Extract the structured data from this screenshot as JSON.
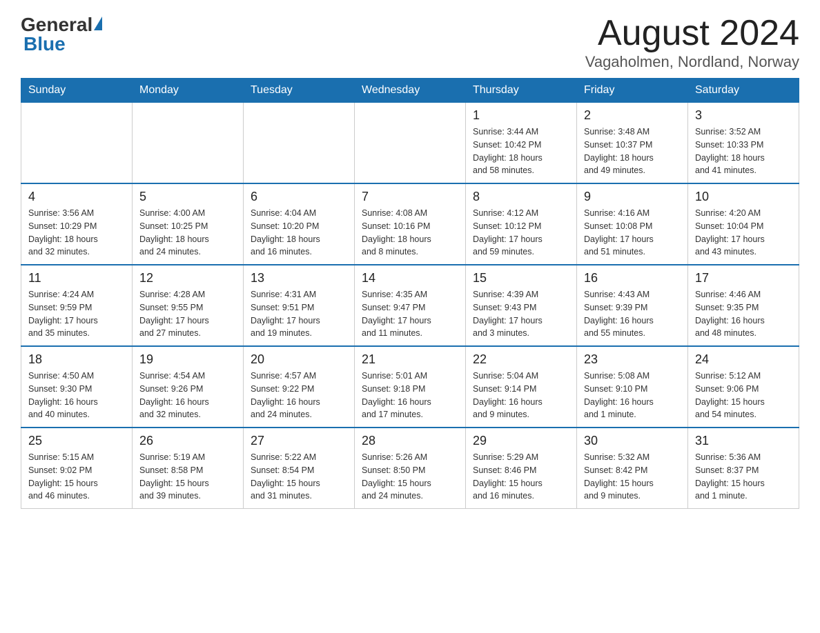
{
  "header": {
    "logo_general": "General",
    "logo_blue": "Blue",
    "month_title": "August 2024",
    "location": "Vagaholmen, Nordland, Norway"
  },
  "weekdays": [
    "Sunday",
    "Monday",
    "Tuesday",
    "Wednesday",
    "Thursday",
    "Friday",
    "Saturday"
  ],
  "weeks": [
    [
      {
        "day": "",
        "info": ""
      },
      {
        "day": "",
        "info": ""
      },
      {
        "day": "",
        "info": ""
      },
      {
        "day": "",
        "info": ""
      },
      {
        "day": "1",
        "info": "Sunrise: 3:44 AM\nSunset: 10:42 PM\nDaylight: 18 hours\nand 58 minutes."
      },
      {
        "day": "2",
        "info": "Sunrise: 3:48 AM\nSunset: 10:37 PM\nDaylight: 18 hours\nand 49 minutes."
      },
      {
        "day": "3",
        "info": "Sunrise: 3:52 AM\nSunset: 10:33 PM\nDaylight: 18 hours\nand 41 minutes."
      }
    ],
    [
      {
        "day": "4",
        "info": "Sunrise: 3:56 AM\nSunset: 10:29 PM\nDaylight: 18 hours\nand 32 minutes."
      },
      {
        "day": "5",
        "info": "Sunrise: 4:00 AM\nSunset: 10:25 PM\nDaylight: 18 hours\nand 24 minutes."
      },
      {
        "day": "6",
        "info": "Sunrise: 4:04 AM\nSunset: 10:20 PM\nDaylight: 18 hours\nand 16 minutes."
      },
      {
        "day": "7",
        "info": "Sunrise: 4:08 AM\nSunset: 10:16 PM\nDaylight: 18 hours\nand 8 minutes."
      },
      {
        "day": "8",
        "info": "Sunrise: 4:12 AM\nSunset: 10:12 PM\nDaylight: 17 hours\nand 59 minutes."
      },
      {
        "day": "9",
        "info": "Sunrise: 4:16 AM\nSunset: 10:08 PM\nDaylight: 17 hours\nand 51 minutes."
      },
      {
        "day": "10",
        "info": "Sunrise: 4:20 AM\nSunset: 10:04 PM\nDaylight: 17 hours\nand 43 minutes."
      }
    ],
    [
      {
        "day": "11",
        "info": "Sunrise: 4:24 AM\nSunset: 9:59 PM\nDaylight: 17 hours\nand 35 minutes."
      },
      {
        "day": "12",
        "info": "Sunrise: 4:28 AM\nSunset: 9:55 PM\nDaylight: 17 hours\nand 27 minutes."
      },
      {
        "day": "13",
        "info": "Sunrise: 4:31 AM\nSunset: 9:51 PM\nDaylight: 17 hours\nand 19 minutes."
      },
      {
        "day": "14",
        "info": "Sunrise: 4:35 AM\nSunset: 9:47 PM\nDaylight: 17 hours\nand 11 minutes."
      },
      {
        "day": "15",
        "info": "Sunrise: 4:39 AM\nSunset: 9:43 PM\nDaylight: 17 hours\nand 3 minutes."
      },
      {
        "day": "16",
        "info": "Sunrise: 4:43 AM\nSunset: 9:39 PM\nDaylight: 16 hours\nand 55 minutes."
      },
      {
        "day": "17",
        "info": "Sunrise: 4:46 AM\nSunset: 9:35 PM\nDaylight: 16 hours\nand 48 minutes."
      }
    ],
    [
      {
        "day": "18",
        "info": "Sunrise: 4:50 AM\nSunset: 9:30 PM\nDaylight: 16 hours\nand 40 minutes."
      },
      {
        "day": "19",
        "info": "Sunrise: 4:54 AM\nSunset: 9:26 PM\nDaylight: 16 hours\nand 32 minutes."
      },
      {
        "day": "20",
        "info": "Sunrise: 4:57 AM\nSunset: 9:22 PM\nDaylight: 16 hours\nand 24 minutes."
      },
      {
        "day": "21",
        "info": "Sunrise: 5:01 AM\nSunset: 9:18 PM\nDaylight: 16 hours\nand 17 minutes."
      },
      {
        "day": "22",
        "info": "Sunrise: 5:04 AM\nSunset: 9:14 PM\nDaylight: 16 hours\nand 9 minutes."
      },
      {
        "day": "23",
        "info": "Sunrise: 5:08 AM\nSunset: 9:10 PM\nDaylight: 16 hours\nand 1 minute."
      },
      {
        "day": "24",
        "info": "Sunrise: 5:12 AM\nSunset: 9:06 PM\nDaylight: 15 hours\nand 54 minutes."
      }
    ],
    [
      {
        "day": "25",
        "info": "Sunrise: 5:15 AM\nSunset: 9:02 PM\nDaylight: 15 hours\nand 46 minutes."
      },
      {
        "day": "26",
        "info": "Sunrise: 5:19 AM\nSunset: 8:58 PM\nDaylight: 15 hours\nand 39 minutes."
      },
      {
        "day": "27",
        "info": "Sunrise: 5:22 AM\nSunset: 8:54 PM\nDaylight: 15 hours\nand 31 minutes."
      },
      {
        "day": "28",
        "info": "Sunrise: 5:26 AM\nSunset: 8:50 PM\nDaylight: 15 hours\nand 24 minutes."
      },
      {
        "day": "29",
        "info": "Sunrise: 5:29 AM\nSunset: 8:46 PM\nDaylight: 15 hours\nand 16 minutes."
      },
      {
        "day": "30",
        "info": "Sunrise: 5:32 AM\nSunset: 8:42 PM\nDaylight: 15 hours\nand 9 minutes."
      },
      {
        "day": "31",
        "info": "Sunrise: 5:36 AM\nSunset: 8:37 PM\nDaylight: 15 hours\nand 1 minute."
      }
    ]
  ]
}
